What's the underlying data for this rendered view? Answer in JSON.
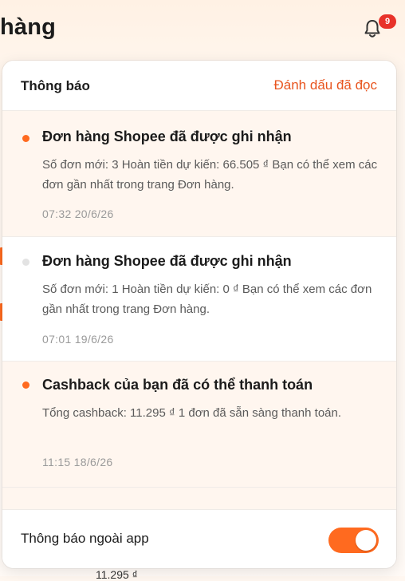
{
  "header": {
    "title_fragment": "hàng",
    "badge_count": "9"
  },
  "panel": {
    "title": "Thông báo",
    "mark_all_read": "Đánh dấu đã đọc"
  },
  "notifications": [
    {
      "unread": true,
      "title": "Đơn hàng Shopee đã được ghi nhận",
      "body": "Số đơn mới: 3 Hoàn tiền dự kiến: 66.505 ₫ Bạn có thể xem các đơn gần nhất trong trang Đơn hàng.",
      "time": "07:32 20/6/26"
    },
    {
      "unread": false,
      "title": "Đơn hàng Shopee đã được ghi nhận",
      "body": "Số đơn mới: 1 Hoàn tiền dự kiến: 0 ₫ Bạn có thể xem các đơn gần nhất trong trang Đơn hàng.",
      "time": "07:01 19/6/26"
    },
    {
      "unread": true,
      "title": "Cashback của bạn đã có thể thanh toán",
      "body": "Tổng cashback: 11.295 ₫ 1 đơn đã sẵn sàng thanh toán.",
      "time": "11:15 18/6/26"
    }
  ],
  "footer": {
    "label": "Thông báo ngoài app",
    "toggle_on": true
  },
  "background": {
    "bottom_text": "11.295 ₫"
  },
  "colors": {
    "accent": "#ff6a1f",
    "link": "#e8541e",
    "badge": "#e8322a",
    "unread_bg": "#fff6ef"
  }
}
